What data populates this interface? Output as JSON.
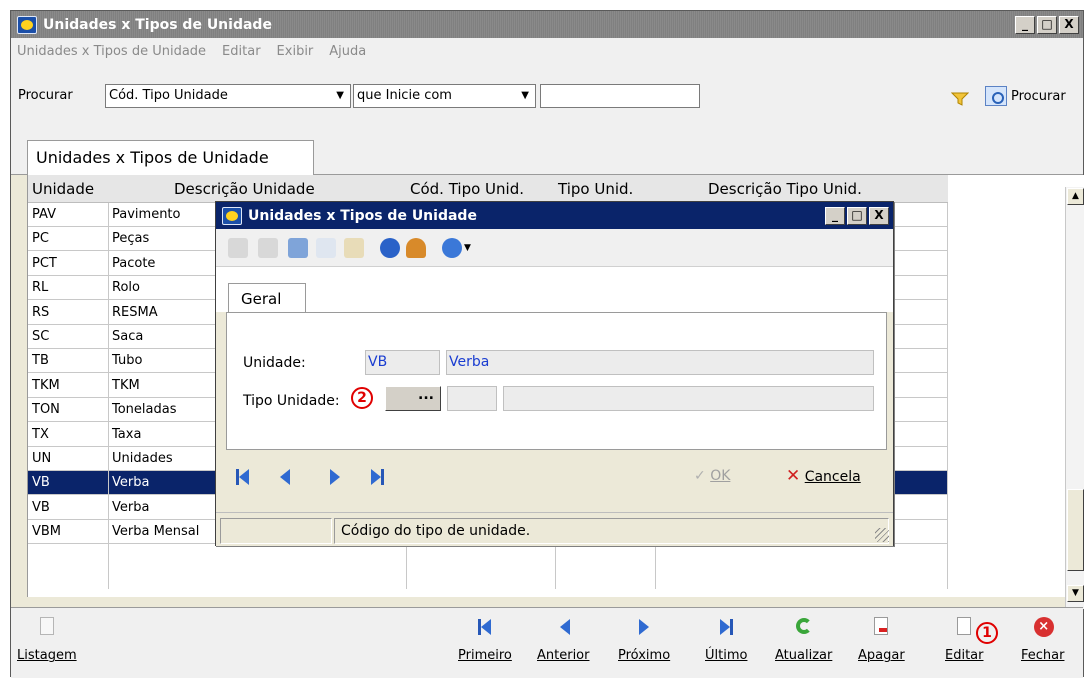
{
  "window": {
    "title": "Unidades x Tipos de Unidade",
    "btn_min": "_",
    "btn_max": "□",
    "btn_close": "X"
  },
  "menu": [
    "Unidades x Tipos de Unidade",
    "Editar",
    "Exibir",
    "Ajuda"
  ],
  "search": {
    "label": "Procurar",
    "field_value": "Cód. Tipo Unidade",
    "operator_value": "que Inicie com",
    "text_value": "",
    "button_label": "Procurar",
    "arrow": "▼"
  },
  "tab": {
    "label": "Unidades x Tipos de Unidade"
  },
  "grid": {
    "columns": [
      "Unidade",
      "Descrição Unidade",
      "Cód. Tipo Unid.",
      "Tipo Unid.",
      "Descrição Tipo Unid."
    ],
    "rows": [
      {
        "unidade": "PAV",
        "descricao": "Pavimento"
      },
      {
        "unidade": "PC",
        "descricao": "Peças"
      },
      {
        "unidade": "PCT",
        "descricao": "Pacote"
      },
      {
        "unidade": "RL",
        "descricao": "Rolo"
      },
      {
        "unidade": "RS",
        "descricao": "RESMA"
      },
      {
        "unidade": "SC",
        "descricao": "Saca"
      },
      {
        "unidade": "TB",
        "descricao": "Tubo"
      },
      {
        "unidade": "TKM",
        "descricao": "TKM"
      },
      {
        "unidade": "TON",
        "descricao": "Toneladas"
      },
      {
        "unidade": "TX",
        "descricao": "Taxa"
      },
      {
        "unidade": "UN",
        "descricao": "Unidades"
      },
      {
        "unidade": "VB",
        "descricao": "Verba"
      },
      {
        "unidade": "VB",
        "descricao": "Verba"
      },
      {
        "unidade": "VBM",
        "descricao": "Verba Mensal"
      }
    ],
    "selected_index": 11,
    "scroll_up": "▲",
    "scroll_down": "▼"
  },
  "toolbar": {
    "listagem": "Listagem",
    "primeiro": "Primeiro",
    "anterior": "Anterior",
    "proximo": "Próximo",
    "ultimo": "Último",
    "atualizar": "Atualizar",
    "apagar": "Apagar",
    "editar": "Editar",
    "fechar": "Fechar",
    "close_glyph": "×"
  },
  "dialog": {
    "title": "Unidades x Tipos de Unidade",
    "tab_label": "Geral",
    "unidade_label": "Unidade:",
    "unidade_code": "VB",
    "unidade_desc": "Verba",
    "tipo_label": "Tipo Unidade:",
    "tipo_code": "",
    "tipo_desc": "",
    "ellipsis": "...",
    "ok_label": "OK",
    "cancel_label": "Cancela",
    "status_left": "",
    "status_text": "Código do tipo de unidade."
  },
  "annotations": {
    "step1": "1",
    "step2": "2"
  },
  "colors": {
    "selection": "#0a246a",
    "title_active": "#0a246a",
    "marker": "#e00000"
  }
}
